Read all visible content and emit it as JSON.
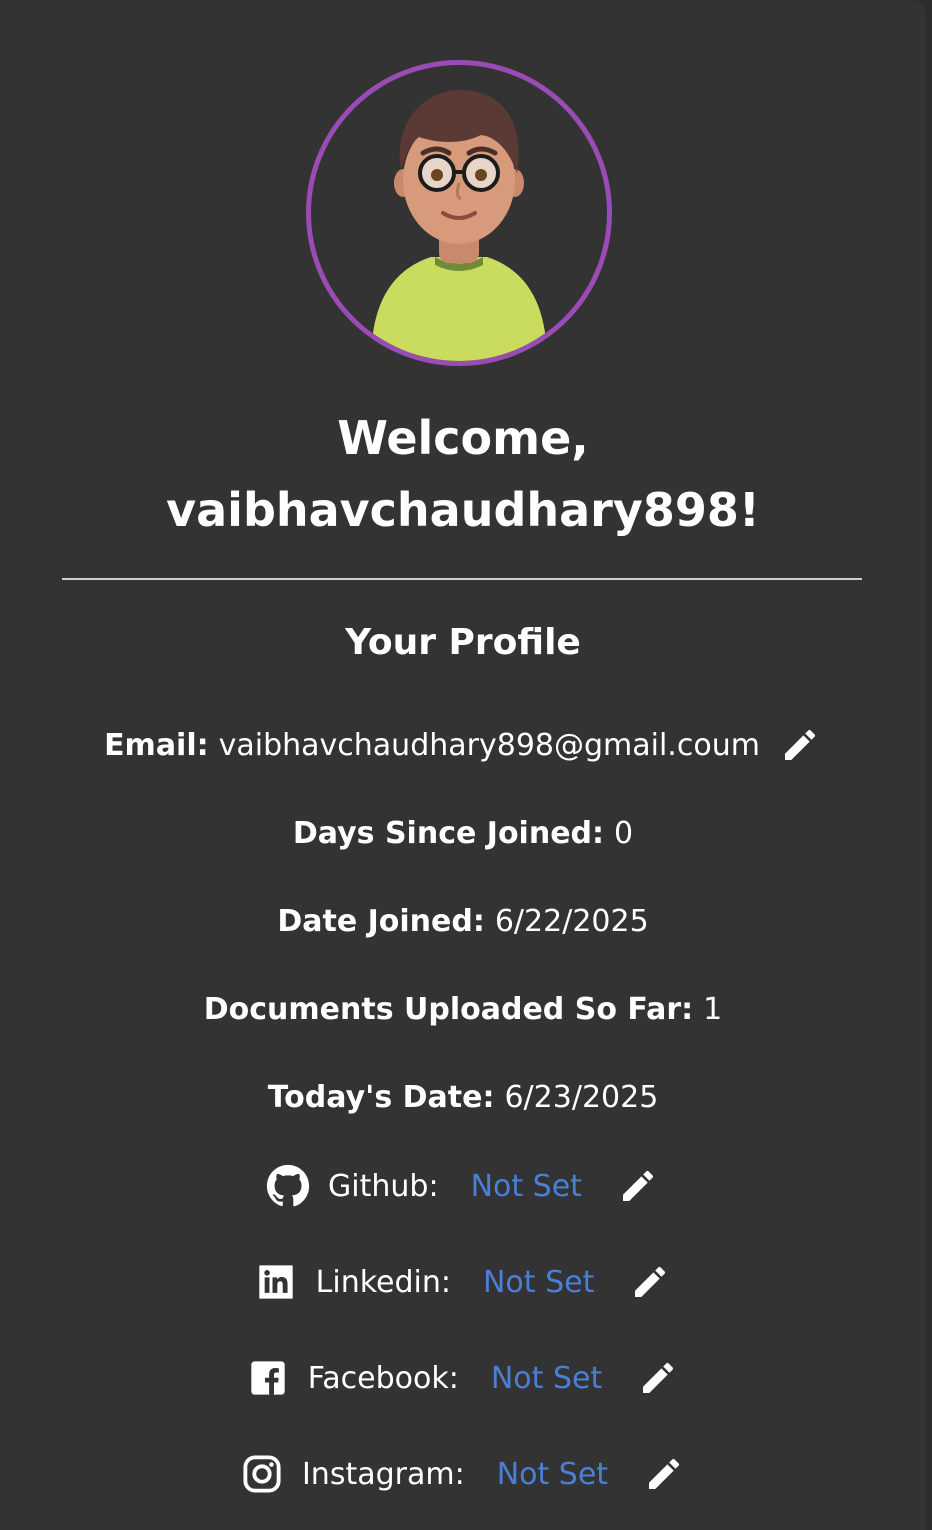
{
  "welcome": {
    "line1": "Welcome,",
    "line2": "vaibhavchaudhary898!"
  },
  "profile": {
    "title": "Your Profile",
    "email_label": "Email:",
    "email_value": "vaibhavchaudhary898@gmail.coum",
    "days_label": "Days Since Joined:",
    "days_value": "0",
    "joined_label": "Date Joined:",
    "joined_value": "6/22/2025",
    "docs_label": "Documents Uploaded So Far:",
    "docs_value": "1",
    "today_label": "Today's Date:",
    "today_value": "6/23/2025"
  },
  "socials": [
    {
      "label": "Github:",
      "value": "Not Set",
      "icon": "github-icon"
    },
    {
      "label": "Linkedin:",
      "value": "Not Set",
      "icon": "linkedin-icon"
    },
    {
      "label": "Facebook:",
      "value": "Not Set",
      "icon": "facebook-icon"
    },
    {
      "label": "Instagram:",
      "value": "Not Set",
      "icon": "instagram-icon"
    }
  ],
  "colors": {
    "background": "#333333",
    "avatar_ring": "#9b4bb5",
    "link": "#4a7fd6"
  }
}
